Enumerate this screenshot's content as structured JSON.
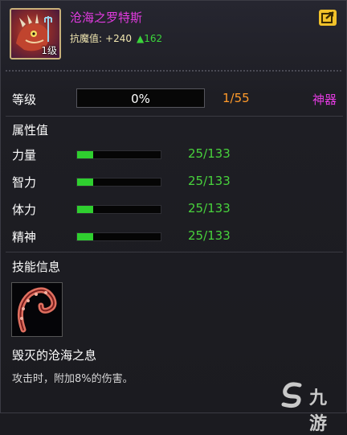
{
  "item": {
    "name": "沧海之罗特斯",
    "level_badge": "1级",
    "resist_label": "抗魔值:",
    "resist_base": "+240",
    "resist_bonus": "▲162"
  },
  "level": {
    "label": "等级",
    "progress_text": "0%",
    "progress": 0,
    "count": "1/55",
    "tier": "神器"
  },
  "attributes": {
    "title": "属性值",
    "items": [
      {
        "label": "力量",
        "value": "25/133",
        "fraction": 0.188
      },
      {
        "label": "智力",
        "value": "25/133",
        "fraction": 0.188
      },
      {
        "label": "体力",
        "value": "25/133",
        "fraction": 0.188
      },
      {
        "label": "精神",
        "value": "25/133",
        "fraction": 0.188
      }
    ]
  },
  "skill": {
    "title": "技能信息",
    "name": "毁灭的沧海之息",
    "description": "攻击时，附加8%的伤害。"
  },
  "watermark": {
    "text": "九游"
  },
  "colors": {
    "name": "#e23be0",
    "tier": "#e23be0",
    "level_count": "#ff9a2a",
    "attr_value": "#48d23c",
    "bar_fill": "#2fcf2f",
    "share_button": "#f2c22a"
  },
  "icons": {
    "share": "share-arrow-icon",
    "skill": "tentacle-icon"
  }
}
